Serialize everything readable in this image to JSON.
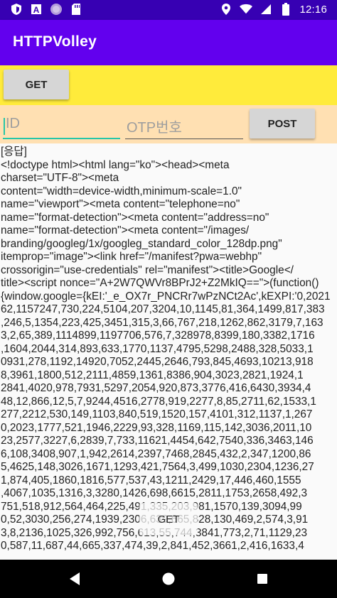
{
  "status_bar": {
    "time": "12:16",
    "left_icons": [
      "shield-icon",
      "font-a-icon",
      "circle-icon",
      "sd-card-icon"
    ],
    "right_icons": [
      "location-icon",
      "wifi-icon",
      "signal-icon",
      "battery-icon"
    ]
  },
  "app_bar": {
    "title": "HTTPVolley"
  },
  "yellow_row": {
    "get_label": "GET"
  },
  "form": {
    "id_placeholder": "ID",
    "otp_placeholder": "OTP번호",
    "post_label": "POST"
  },
  "response": {
    "lines": [
      "[응답]",
      "<!doctype html><html lang=\"ko\"><head><meta",
      "charset=\"UTF-8\"><meta",
      "content=\"width=device-width,minimum-scale=1.0\"",
      "name=\"viewport\"><meta content=\"telephone=no\"",
      "name=\"format-detection\"><meta content=\"address=no\"",
      "name=\"format-detection\"><meta content=\"/images/",
      "branding/googleg/1x/googleg_standard_color_128dp.png\"",
      "itemprop=\"image\"><link href=\"/manifest?pwa=webhp\"",
      "crossorigin=\"use-credentials\" rel=\"manifest\"><title>Google</",
      "title><script nonce=\"A+2W7QWVr8BPrJ2+Z2MkIQ==\">(function()",
      "{window.google={kEI:'_e_OX7r_PNCRr7wPzNCt2Ac',kEXPI:'0,2021",
      "62,1157247,730,224,5104,207,3204,10,1145,81,364,1499,817,383",
      ",246,5,1354,223,425,3451,315,3,66,767,218,1262,862,3179,7,163",
      "3,2,65,389,1114899,1197706,576,7,328978,8399,180,3382,1716",
      ",1604,2044,314,893,633,1770,1137,4795,5298,2488,328,5033,1",
      "0931,278,1192,14920,7052,2445,2646,793,845,4693,10213,918",
      "8,3961,1800,512,2111,4859,1361,8386,904,3023,2821,1924,1",
      "2841,4020,978,7931,5297,2054,920,873,3776,416,6430,3934,4",
      "48,12,866,12,5,7,9244,4516,2778,919,2277,8,85,2711,62,1533,1",
      "277,2212,530,149,1103,840,519,1520,157,4101,312,1137,1,267",
      "0,2023,1777,521,1946,2229,93,328,1169,115,142,3036,2011,10",
      "23,2577,3227,6,2839,7,733,11621,4454,642,7540,336,3463,146",
      "6,108,3408,907,1,942,2614,2397,7468,2845,432,2,347,1200,86",
      "5,4625,148,3026,1671,1293,421,7564,3,499,1030,2304,1236,27",
      "1,874,405,1860,1816,577,537,43,1211,2429,17,446,460,1555",
      ",4067,1035,1316,3,3280,1426,698,6615,2811,1753,2658,492,3",
      "751,518,912,564,464,225,491,335,203,981,1570,139,3094,99",
      "0,52,3030,256,274,1939,2306,639,665,828,130,469,2,574,3,91",
      "3,8,2136,1025,326,992,756,613,55,744,3841,773,2,71,1129,23",
      "0,587,11,687,44,665,337,474,39,2,841,452,3661,2,416,1633,4"
    ]
  },
  "floating_get_label": "GET",
  "nav_bar": {
    "buttons": [
      "back-icon",
      "home-icon",
      "recents-icon"
    ]
  },
  "colors": {
    "status_bar": "#3700b3",
    "app_bar": "#6200ee",
    "yellow_row": "#ffeb3b",
    "peach_row": "#ffe0b2",
    "accent": "#26c6a8"
  }
}
